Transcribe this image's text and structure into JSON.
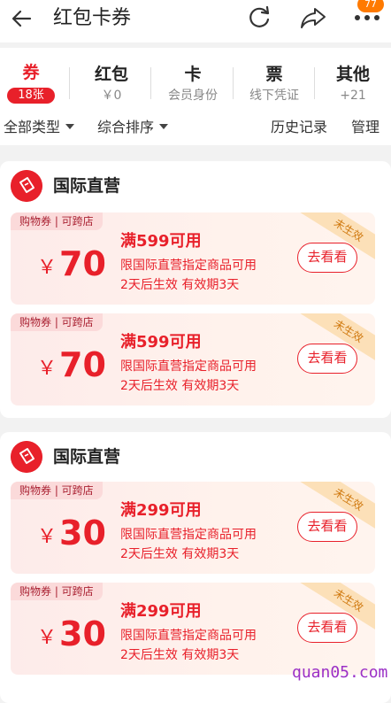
{
  "header": {
    "title": "红包卡券",
    "badge": "77",
    "icons": [
      "back-arrow-icon",
      "refresh-icon",
      "share-icon",
      "more-icon"
    ]
  },
  "tabs": [
    {
      "title": "券",
      "sub": "18张",
      "active": true
    },
    {
      "title": "红包",
      "sub": "￥0"
    },
    {
      "title": "卡",
      "sub": "会员身份"
    },
    {
      "title": "票",
      "sub": "线下凭证"
    },
    {
      "title": "其他",
      "sub": "+21"
    }
  ],
  "filters": {
    "type": "全部类型",
    "sort": "综合排序",
    "history": "历史记录",
    "manage": "管理"
  },
  "groups": [
    {
      "name": "国际直营",
      "coupons": [
        {
          "tag": "购物券 | 可跨店",
          "currency": "￥",
          "amount": "70",
          "condition": "满599可用",
          "desc1": "限国际直营指定商品可用",
          "desc2": "2天后生效 有效期3天",
          "button": "去看看",
          "status": "未生效"
        },
        {
          "tag": "购物券 | 可跨店",
          "currency": "￥",
          "amount": "70",
          "condition": "满599可用",
          "desc1": "限国际直营指定商品可用",
          "desc2": "2天后生效 有效期3天",
          "button": "去看看",
          "status": "未生效"
        }
      ]
    },
    {
      "name": "国际直营",
      "coupons": [
        {
          "tag": "购物券 | 可跨店",
          "currency": "￥",
          "amount": "30",
          "condition": "满299可用",
          "desc1": "限国际直营指定商品可用",
          "desc2": "2天后生效 有效期3天",
          "button": "去看看",
          "status": "未生效"
        },
        {
          "tag": "购物券 | 可跨店",
          "currency": "￥",
          "amount": "30",
          "condition": "满299可用",
          "desc1": "限国际直营指定商品可用",
          "desc2": "2天后生效 有效期3天",
          "button": "去看看",
          "status": "未生效"
        }
      ]
    }
  ],
  "watermark": "quan05.com",
  "colors": {
    "accent": "#e8202a",
    "badge": "#ff7a00",
    "ribbon": "#fce0b8"
  }
}
